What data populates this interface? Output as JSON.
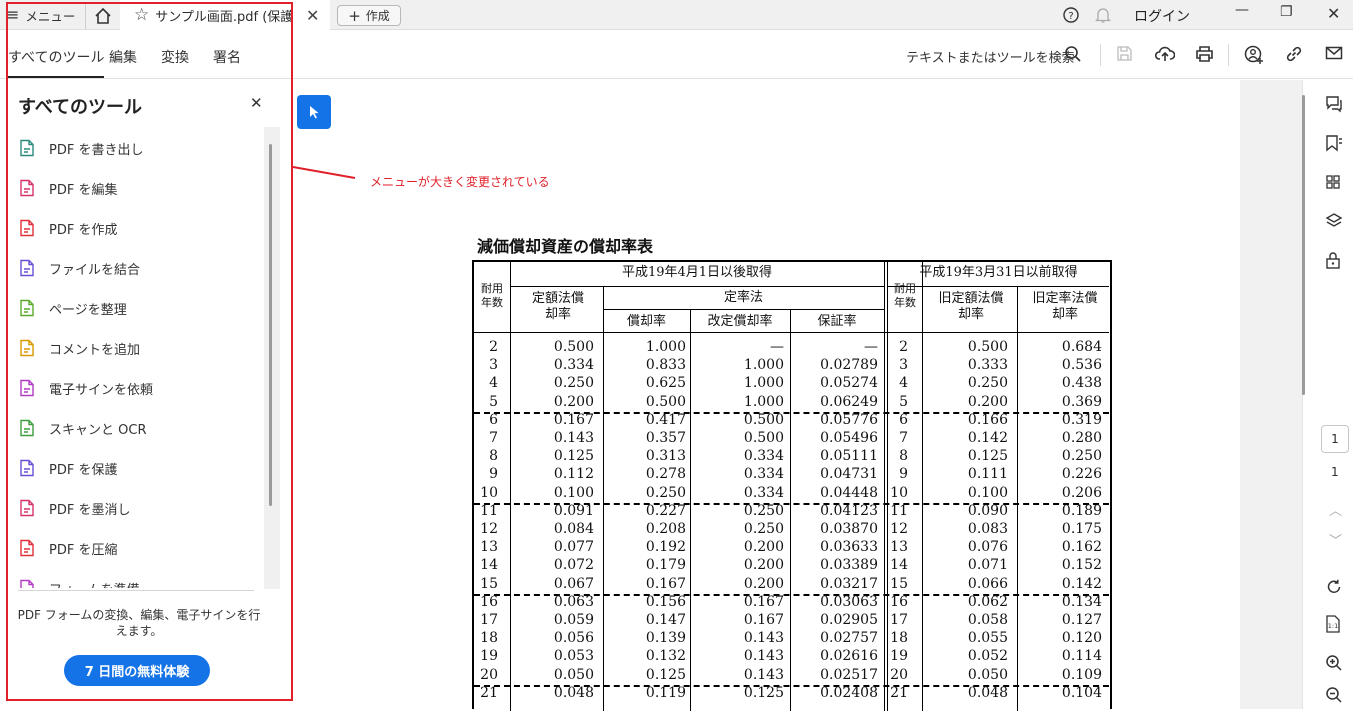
{
  "titlebar": {
    "menu_label": "メニュー",
    "doc_tab_label": "サンプル画面.pdf (保護",
    "create_label": "作成",
    "login_label": "ログイン"
  },
  "toolbar": {
    "tabs": [
      "すべてのツール",
      "編集",
      "変換",
      "署名"
    ],
    "search_label": "テキストまたはツールを検索"
  },
  "panel": {
    "title": "すべてのツール",
    "tools": [
      {
        "label": "PDF を書き出し",
        "icon": "export-pdf-icon",
        "color": "#2a8a7c"
      },
      {
        "label": "PDF を編集",
        "icon": "edit-pdf-icon",
        "color": "#d6336c"
      },
      {
        "label": "PDF を作成",
        "icon": "create-pdf-icon",
        "color": "#e0303a"
      },
      {
        "label": "ファイルを結合",
        "icon": "combine-files-icon",
        "color": "#6a4fd6"
      },
      {
        "label": "ページを整理",
        "icon": "organize-pages-icon",
        "color": "#5aaa2a"
      },
      {
        "label": "コメントを追加",
        "icon": "add-comment-icon",
        "color": "#d99a00"
      },
      {
        "label": "電子サインを依頼",
        "icon": "request-esign-icon",
        "color": "#b13ac4"
      },
      {
        "label": "スキャンと OCR",
        "icon": "scan-ocr-icon",
        "color": "#3f9e3f"
      },
      {
        "label": "PDF を保護",
        "icon": "protect-pdf-icon",
        "color": "#6a4fd6"
      },
      {
        "label": "PDF を墨消し",
        "icon": "redact-pdf-icon",
        "color": "#d6336c"
      },
      {
        "label": "PDF を圧縮",
        "icon": "compress-pdf-icon",
        "color": "#e0303a"
      },
      {
        "label": "フォームを準備",
        "icon": "prepare-form-icon",
        "color": "#b13ac4"
      }
    ],
    "promo_text": "PDF フォームの変換、編集、電子サインを行えます。",
    "trial_button": "7 日間の無料体験"
  },
  "annotation": {
    "text": "メニューが大きく変更されている",
    "color": "#e0202a"
  },
  "document": {
    "title": "減価償却資産の償却率表",
    "header_after": "平成19年4月1日以後取得",
    "header_before": "平成19年3月31日以前取得",
    "col_life": "耐用年数",
    "col_fixed": "定額法償却率",
    "col_declining": "定率法",
    "col_rate": "償却率",
    "col_revised": "改定償却率",
    "col_guarantee": "保証率",
    "col_old_fixed": "旧定額法償却率",
    "col_old_declining": "旧定率法償却率",
    "rows": [
      [
        "2",
        "0.500",
        "1.000",
        "—",
        "—",
        "2",
        "0.500",
        "0.684"
      ],
      [
        "3",
        "0.334",
        "0.833",
        "1.000",
        "0.02789",
        "3",
        "0.333",
        "0.536"
      ],
      [
        "4",
        "0.250",
        "0.625",
        "1.000",
        "0.05274",
        "4",
        "0.250",
        "0.438"
      ],
      [
        "5",
        "0.200",
        "0.500",
        "1.000",
        "0.06249",
        "5",
        "0.200",
        "0.369"
      ],
      [
        "6",
        "0.167",
        "0.417",
        "0.500",
        "0.05776",
        "6",
        "0.166",
        "0.319"
      ],
      [
        "7",
        "0.143",
        "0.357",
        "0.500",
        "0.05496",
        "7",
        "0.142",
        "0.280"
      ],
      [
        "8",
        "0.125",
        "0.313",
        "0.334",
        "0.05111",
        "8",
        "0.125",
        "0.250"
      ],
      [
        "9",
        "0.112",
        "0.278",
        "0.334",
        "0.04731",
        "9",
        "0.111",
        "0.226"
      ],
      [
        "10",
        "0.100",
        "0.250",
        "0.334",
        "0.04448",
        "10",
        "0.100",
        "0.206"
      ],
      [
        "11",
        "0.091",
        "0.227",
        "0.250",
        "0.04123",
        "11",
        "0.090",
        "0.189"
      ],
      [
        "12",
        "0.084",
        "0.208",
        "0.250",
        "0.03870",
        "12",
        "0.083",
        "0.175"
      ],
      [
        "13",
        "0.077",
        "0.192",
        "0.200",
        "0.03633",
        "13",
        "0.076",
        "0.162"
      ],
      [
        "14",
        "0.072",
        "0.179",
        "0.200",
        "0.03389",
        "14",
        "0.071",
        "0.152"
      ],
      [
        "15",
        "0.067",
        "0.167",
        "0.200",
        "0.03217",
        "15",
        "0.066",
        "0.142"
      ],
      [
        "16",
        "0.063",
        "0.156",
        "0.167",
        "0.03063",
        "16",
        "0.062",
        "0.134"
      ],
      [
        "17",
        "0.059",
        "0.147",
        "0.167",
        "0.02905",
        "17",
        "0.058",
        "0.127"
      ],
      [
        "18",
        "0.056",
        "0.139",
        "0.143",
        "0.02757",
        "18",
        "0.055",
        "0.120"
      ],
      [
        "19",
        "0.053",
        "0.132",
        "0.143",
        "0.02616",
        "19",
        "0.052",
        "0.114"
      ],
      [
        "20",
        "0.050",
        "0.125",
        "0.143",
        "0.02517",
        "20",
        "0.050",
        "0.109"
      ],
      [
        "21",
        "0.048",
        "0.119",
        "0.125",
        "0.02408",
        "21",
        "0.048",
        "0.104"
      ]
    ]
  },
  "page_nav": {
    "current_page": "1",
    "total_pages": "1"
  }
}
